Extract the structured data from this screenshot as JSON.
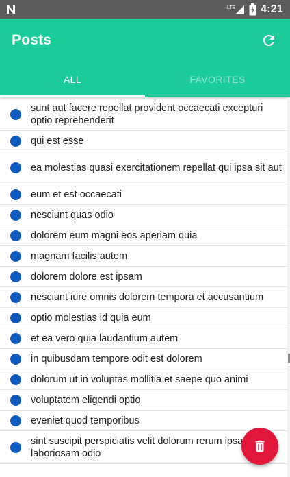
{
  "status_bar": {
    "carrier_icon": "n-logo-icon",
    "network_label": "LTE",
    "time": "4:21"
  },
  "app_bar": {
    "title": "Posts",
    "refresh_icon": "refresh-icon"
  },
  "tabs": [
    {
      "label": "ALL",
      "active": true
    },
    {
      "label": "FAVORITES",
      "active": false
    }
  ],
  "posts": [
    {
      "title": "sunt aut facere repellat provident occaecati excepturi optio reprehenderit"
    },
    {
      "title": "qui est esse"
    },
    {
      "title": "ea molestias quasi exercitationem repellat qui ipsa sit aut"
    },
    {
      "title": "eum et est occaecati"
    },
    {
      "title": "nesciunt quas odio"
    },
    {
      "title": "dolorem eum magni eos aperiam quia"
    },
    {
      "title": "magnam facilis autem"
    },
    {
      "title": "dolorem dolore est ipsam"
    },
    {
      "title": "nesciunt iure omnis dolorem tempora et accusantium"
    },
    {
      "title": "optio molestias id quia eum"
    },
    {
      "title": "et ea vero quia laudantium autem"
    },
    {
      "title": "in quibusdam tempore odit est dolorem"
    },
    {
      "title": "dolorum ut in voluptas mollitia et saepe quo animi"
    },
    {
      "title": "voluptatem eligendi optio"
    },
    {
      "title": "eveniet quod temporibus"
    },
    {
      "title": "sint suscipit perspiciatis velit dolorum rerum ipsa laboriosam odio"
    }
  ],
  "fab": {
    "icon": "trash-icon"
  },
  "colors": {
    "primary": "#1ccb9a",
    "dot": "#0f5cc0",
    "fab": "#e1163a"
  }
}
